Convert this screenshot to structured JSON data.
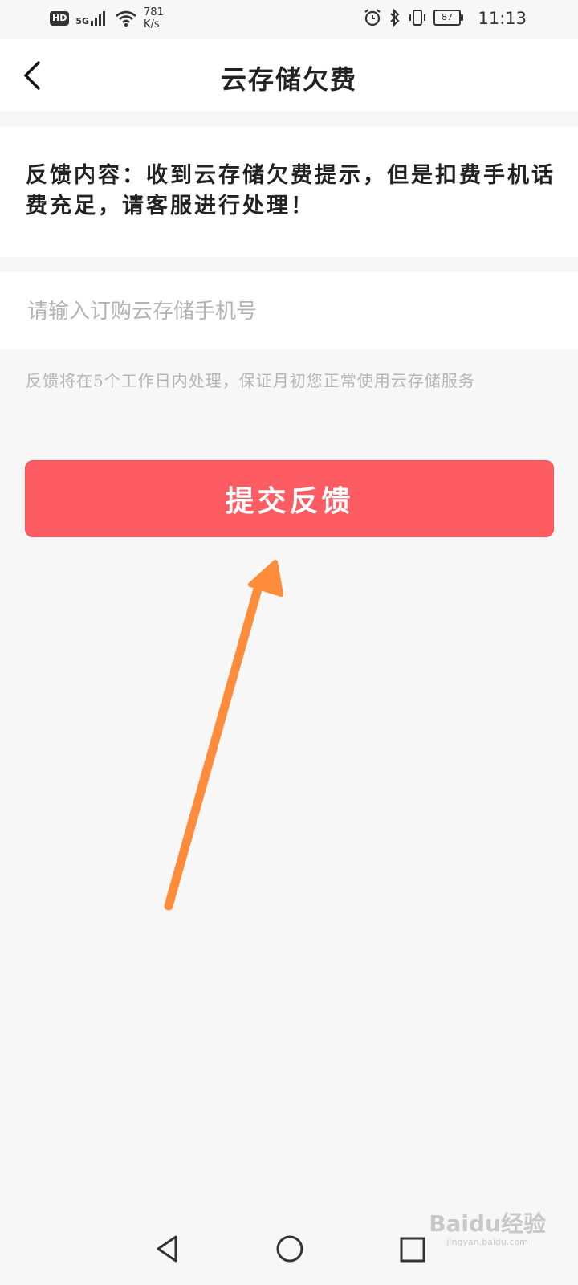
{
  "status_bar": {
    "hd_badge": "HD",
    "network_label": "5G",
    "speed_value": "781",
    "speed_unit": "K/s",
    "battery_level": "87",
    "time": "11:13"
  },
  "header": {
    "title": "云存储欠费",
    "back_icon": "chevron-left-icon"
  },
  "feedback": {
    "content": "反馈内容：收到云存储欠费提示，但是扣费手机话费充足，请客服进行处理！",
    "phone_placeholder": "请输入订购云存储手机号",
    "phone_value": "",
    "hint": "反馈将在5个工作日内处理，保证月初您正常使用云存储服务",
    "submit_label": "提交反馈"
  },
  "annotation": {
    "arrow_icon": "arrow-up-icon",
    "arrow_color": "#ff8c3a"
  },
  "nav_bar": {
    "back_icon": "triangle-back-icon",
    "home_icon": "circle-home-icon",
    "recent_icon": "square-recent-icon"
  },
  "watermark": {
    "main": "Baidu经验",
    "sub": "jingyan.baidu.com"
  },
  "colors": {
    "accent": "#fd5c63",
    "background": "#f7f7f7",
    "card": "#ffffff"
  }
}
